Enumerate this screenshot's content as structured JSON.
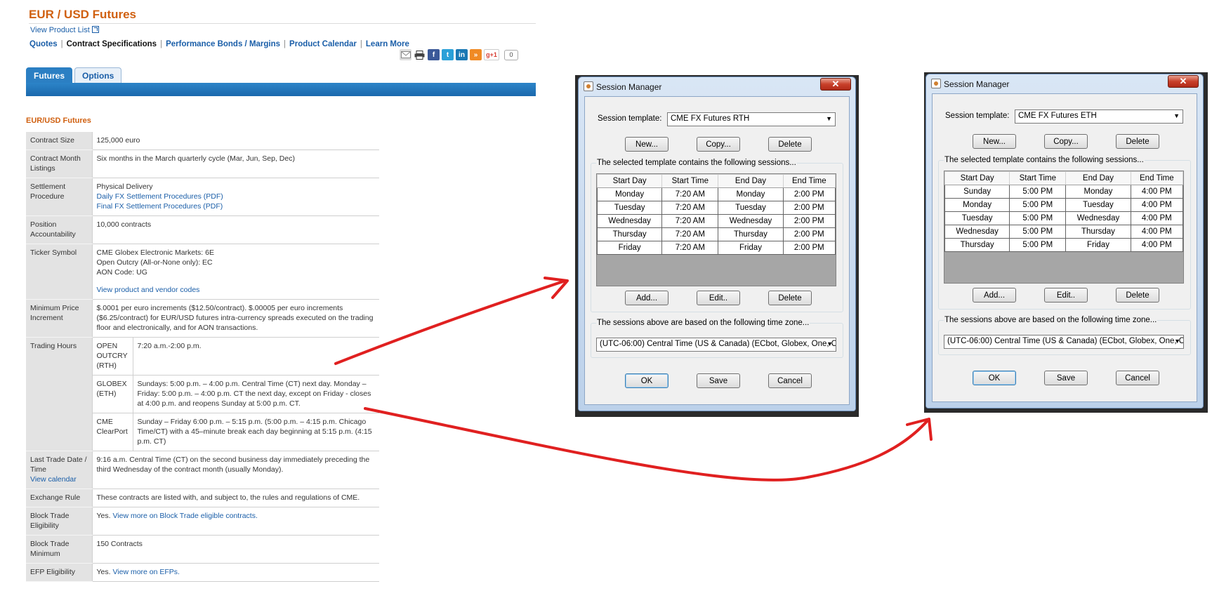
{
  "web": {
    "title": "EUR / USD Futures",
    "view_product_list": "View Product List",
    "subnav": {
      "quotes": "Quotes",
      "contract_specs": "Contract Specifications",
      "bonds": "Performance Bonds / Margins",
      "calendar": "Product Calendar",
      "learn_more": "Learn More",
      "separator": "|"
    },
    "share": {
      "icons": [
        "email-icon",
        "print-icon",
        "facebook-icon",
        "twitter-icon",
        "linkedin-icon",
        "rss-icon",
        "google-plus-icon"
      ],
      "facebook": "f",
      "twitter": "t",
      "linkedin": "in",
      "rss": "»",
      "google_plus": "g+1",
      "count": "0"
    },
    "tabs": {
      "futures": "Futures",
      "options": "Options"
    },
    "section_title": "EUR/USD Futures",
    "spec": {
      "contract_size": {
        "label": "Contract Size",
        "value": "125,000 euro"
      },
      "contract_month": {
        "label": "Contract Month Listings",
        "value": "Six months in the March quarterly cycle (Mar, Jun, Sep, Dec)"
      },
      "settlement": {
        "label": "Settlement Procedure",
        "value": "Physical Delivery",
        "link1": "Daily FX Settlement Procedures (PDF)",
        "link2": "Final FX Settlement Procedures (PDF)"
      },
      "position": {
        "label": "Position Accountability",
        "value": "10,000 contracts"
      },
      "ticker": {
        "label": "Ticker Symbol",
        "line1": "CME Globex Electronic Markets: 6E",
        "line2": "Open Outcry (All-or-None only): EC",
        "line3": "AON Code: UG",
        "link": "View product and vendor codes"
      },
      "min_price": {
        "label": "Minimum Price Increment",
        "value": "$.0001 per euro increments ($12.50/contract). $.00005 per euro increments ($6.25/contract) for EUR/USD futures intra-currency spreads executed on the trading floor and electronically, and for AON transactions."
      },
      "trading_hours": {
        "label": "Trading Hours",
        "outcry_label": "OPEN OUTCRY (RTH)",
        "outcry_value": "7:20 a.m.-2:00 p.m.",
        "globex_label": "GLOBEX (ETH)",
        "globex_value": "Sundays: 5:00 p.m. – 4:00 p.m. Central Time (CT) next day. Monday – Friday: 5:00 p.m. – 4:00 p.m. CT the next day, except on Friday - closes at 4:00 p.m. and reopens Sunday at 5:00 p.m. CT.",
        "clearport_label": "CME ClearPort",
        "clearport_value": "Sunday – Friday 6:00 p.m. – 5:15 p.m. (5:00 p.m. – 4:15 p.m. Chicago Time/CT) with a 45–minute break each day beginning at 5:15 p.m. (4:15 p.m. CT)"
      },
      "last_trade": {
        "label": "Last Trade Date / Time",
        "label_link": "View calendar",
        "value": "9:16 a.m. Central Time (CT) on the second business day immediately preceding the third Wednesday of the contract month (usually Monday)."
      },
      "exchange_rule": {
        "label": "Exchange Rule",
        "value": "These contracts are listed with, and subject to, the rules and regulations of CME."
      },
      "block_trade": {
        "label": "Block Trade Eligibility",
        "prefix": "Yes.",
        "link": "View more on Block Trade eligible contracts."
      },
      "block_min": {
        "label": "Block Trade Minimum",
        "value": "150 Contracts"
      },
      "efp": {
        "label": "EFP Eligibility",
        "prefix": "Yes.",
        "link": "View more on EFPs."
      }
    }
  },
  "dialog_common": {
    "title": "Session Manager",
    "close": "✕",
    "template_label": "Session template:",
    "new": "New...",
    "copy": "Copy...",
    "delete": "Delete",
    "sessions_label": "The selected template contains the following sessions...",
    "headers": [
      "Start Day",
      "Start Time",
      "End Day",
      "End Time"
    ],
    "add": "Add...",
    "edit": "Edit..",
    "timezone_label": "The sessions above are based on the following time zone...",
    "timezone": "(UTC-06:00) Central Time (US & Canada) (ECbot, Globex, One, C",
    "ok": "OK",
    "save": "Save",
    "cancel": "Cancel",
    "dropdown_arrow": "▼"
  },
  "dialog_rth": {
    "template": "CME FX Futures RTH",
    "rows": [
      [
        "Monday",
        "7:20 AM",
        "Monday",
        "2:00 PM"
      ],
      [
        "Tuesday",
        "7:20 AM",
        "Tuesday",
        "2:00 PM"
      ],
      [
        "Wednesday",
        "7:20 AM",
        "Wednesday",
        "2:00 PM"
      ],
      [
        "Thursday",
        "7:20 AM",
        "Thursday",
        "2:00 PM"
      ],
      [
        "Friday",
        "7:20 AM",
        "Friday",
        "2:00 PM"
      ]
    ]
  },
  "dialog_eth": {
    "template": "CME FX Futures ETH",
    "rows": [
      [
        "Sunday",
        "5:00 PM",
        "Monday",
        "4:00 PM"
      ],
      [
        "Monday",
        "5:00 PM",
        "Tuesday",
        "4:00 PM"
      ],
      [
        "Tuesday",
        "5:00 PM",
        "Wednesday",
        "4:00 PM"
      ],
      [
        "Wednesday",
        "5:00 PM",
        "Thursday",
        "4:00 PM"
      ],
      [
        "Thursday",
        "5:00 PM",
        "Friday",
        "4:00 PM"
      ]
    ]
  },
  "colors": {
    "brand_orange": "#d06010",
    "link_blue": "#1a5ea8",
    "tab_blue": "#2b7fc3",
    "arrow_red": "#e02020"
  }
}
